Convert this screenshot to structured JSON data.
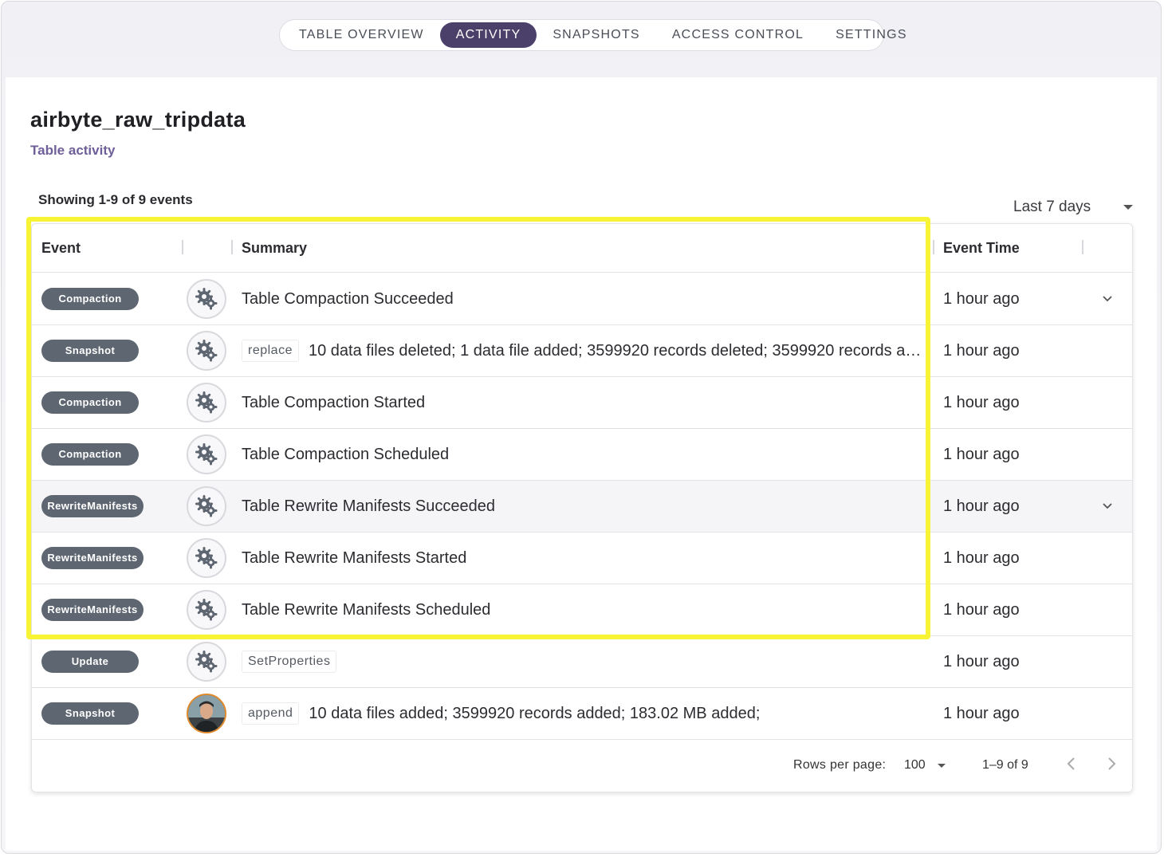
{
  "tabs": [
    {
      "label": "TABLE OVERVIEW",
      "active": false
    },
    {
      "label": "ACTIVITY",
      "active": true
    },
    {
      "label": "SNAPSHOTS",
      "active": false
    },
    {
      "label": "ACCESS CONTROL",
      "active": false
    },
    {
      "label": "SETTINGS",
      "active": false
    }
  ],
  "page": {
    "title": "airbyte_raw_tripdata",
    "subtitle": "Table activity"
  },
  "showing": "Showing 1-9 of 9 events",
  "range_select": {
    "value": "Last 7 days"
  },
  "table": {
    "headers": {
      "event": "Event",
      "summary": "Summary",
      "event_time": "Event Time"
    },
    "rows": [
      {
        "event": "Compaction",
        "icon": "gears-icon",
        "chip": "",
        "summary": "Table Compaction Succeeded",
        "time": "1 hour ago",
        "expandable": true
      },
      {
        "event": "Snapshot",
        "icon": "gears-icon",
        "chip": "replace",
        "summary": "10 data files deleted; 1 data file added; 3599920 records deleted; 3599920 records adde…",
        "time": "1 hour ago",
        "expandable": false
      },
      {
        "event": "Compaction",
        "icon": "gears-icon",
        "chip": "",
        "summary": "Table Compaction Started",
        "time": "1 hour ago",
        "expandable": false
      },
      {
        "event": "Compaction",
        "icon": "gears-icon",
        "chip": "",
        "summary": "Table Compaction Scheduled",
        "time": "1 hour ago",
        "expandable": false
      },
      {
        "event": "RewriteManifests",
        "icon": "gears-icon",
        "chip": "",
        "summary": "Table Rewrite Manifests Succeeded",
        "time": "1 hour ago",
        "expandable": true
      },
      {
        "event": "RewriteManifests",
        "icon": "gears-icon",
        "chip": "",
        "summary": "Table Rewrite Manifests Started",
        "time": "1 hour ago",
        "expandable": false
      },
      {
        "event": "RewriteManifests",
        "icon": "gears-icon",
        "chip": "",
        "summary": "Table Rewrite Manifests Scheduled",
        "time": "1 hour ago",
        "expandable": false
      },
      {
        "event": "Update",
        "icon": "gears-icon",
        "chip": "SetProperties",
        "summary": "",
        "time": "1 hour ago",
        "expandable": false
      },
      {
        "event": "Snapshot",
        "icon": "user-avatar",
        "chip": "append",
        "summary": "10 data files added; 3599920 records added; 183.02 MB added;",
        "time": "1 hour ago",
        "expandable": false
      }
    ]
  },
  "footer": {
    "rows_per_page_label": "Rows per page:",
    "rows_per_page_value": "100",
    "range_text": "1–9 of 9"
  },
  "colors": {
    "active_tab": "#4a4069",
    "badge": "#5e6671",
    "subtitle": "#6e5f98",
    "highlight": "#f7f436"
  }
}
